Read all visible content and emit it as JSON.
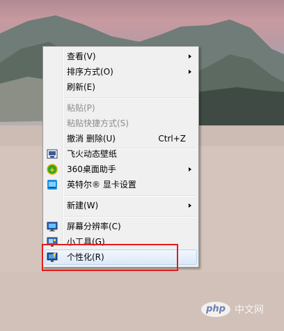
{
  "context_menu": {
    "items": [
      {
        "label": "查看(V)",
        "has_submenu": true,
        "enabled": true
      },
      {
        "label": "排序方式(O)",
        "has_submenu": true,
        "enabled": true
      },
      {
        "label": "刷新(E)",
        "enabled": true
      },
      {
        "label": "粘贴(P)",
        "enabled": false
      },
      {
        "label": "粘贴快捷方式(S)",
        "enabled": false
      },
      {
        "label": "撤消 删除(U)",
        "shortcut": "Ctrl+Z",
        "enabled": true
      },
      {
        "label": "飞火动态壁纸",
        "icon": "wallpaper-app-icon",
        "enabled": true
      },
      {
        "label": "360桌面助手",
        "icon": "360-assistant-icon",
        "has_submenu": true,
        "enabled": true
      },
      {
        "label": "英特尔® 显卡设置",
        "icon": "intel-graphics-icon",
        "enabled": true
      },
      {
        "label": "新建(W)",
        "has_submenu": true,
        "enabled": true
      },
      {
        "label": "屏幕分辨率(C)",
        "icon": "monitor-icon",
        "enabled": true
      },
      {
        "label": "小工具(G)",
        "icon": "gadgets-icon",
        "enabled": true
      },
      {
        "label": "个性化(R)",
        "icon": "personalize-icon",
        "enabled": true,
        "hovered": true
      }
    ]
  },
  "highlight": {
    "color": "#e21b1b",
    "target": "个性化(R)"
  },
  "watermark": {
    "logo": "php",
    "text": "中文网"
  }
}
